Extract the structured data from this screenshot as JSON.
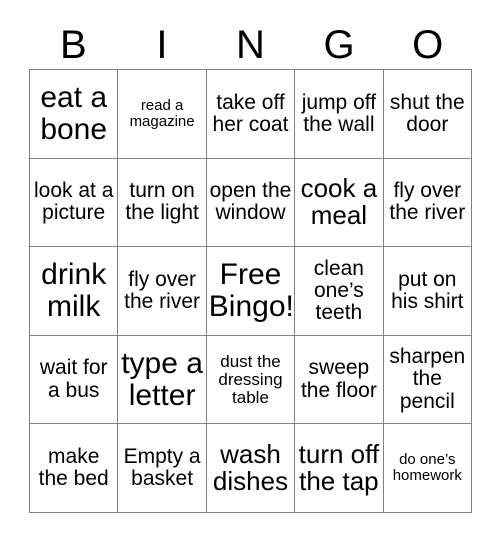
{
  "card": {
    "header": {
      "letters": [
        "B",
        "I",
        "N",
        "G",
        "O"
      ]
    },
    "rows": [
      [
        {
          "text": "eat a bone",
          "size": "xl"
        },
        {
          "text": "read a magazine",
          "size": "xs"
        },
        {
          "text": "take off her coat",
          "size": "md"
        },
        {
          "text": "jump off the wall",
          "size": "md"
        },
        {
          "text": "shut the door",
          "size": "md"
        }
      ],
      [
        {
          "text": "look at a picture",
          "size": "md"
        },
        {
          "text": "turn on the light",
          "size": "md"
        },
        {
          "text": "open the window",
          "size": "md"
        },
        {
          "text": "cook a meal",
          "size": "lg"
        },
        {
          "text": "fly over the river",
          "size": "md"
        }
      ],
      [
        {
          "text": "drink milk",
          "size": "xl"
        },
        {
          "text": "fly over the river",
          "size": "md"
        },
        {
          "text": "Free Bingo!",
          "size": "xl"
        },
        {
          "text": "clean one’s teeth",
          "size": "md"
        },
        {
          "text": "put on his shirt",
          "size": "md"
        }
      ],
      [
        {
          "text": "wait for a bus",
          "size": "md"
        },
        {
          "text": "type a letter",
          "size": "xl"
        },
        {
          "text": "dust the dressing table",
          "size": "sm"
        },
        {
          "text": "sweep the floor",
          "size": "md"
        },
        {
          "text": "sharpen the pencil",
          "size": "md"
        }
      ],
      [
        {
          "text": "make the bed",
          "size": "md"
        },
        {
          "text": "Empty a basket",
          "size": "md"
        },
        {
          "text": "wash dishes",
          "size": "lg"
        },
        {
          "text": "turn off the tap",
          "size": "lg"
        },
        {
          "text": "do one’s homework",
          "size": "xs"
        }
      ]
    ],
    "colors": {
      "background": "#ffffff",
      "text": "#000000",
      "grid_line": "#808080"
    }
  }
}
